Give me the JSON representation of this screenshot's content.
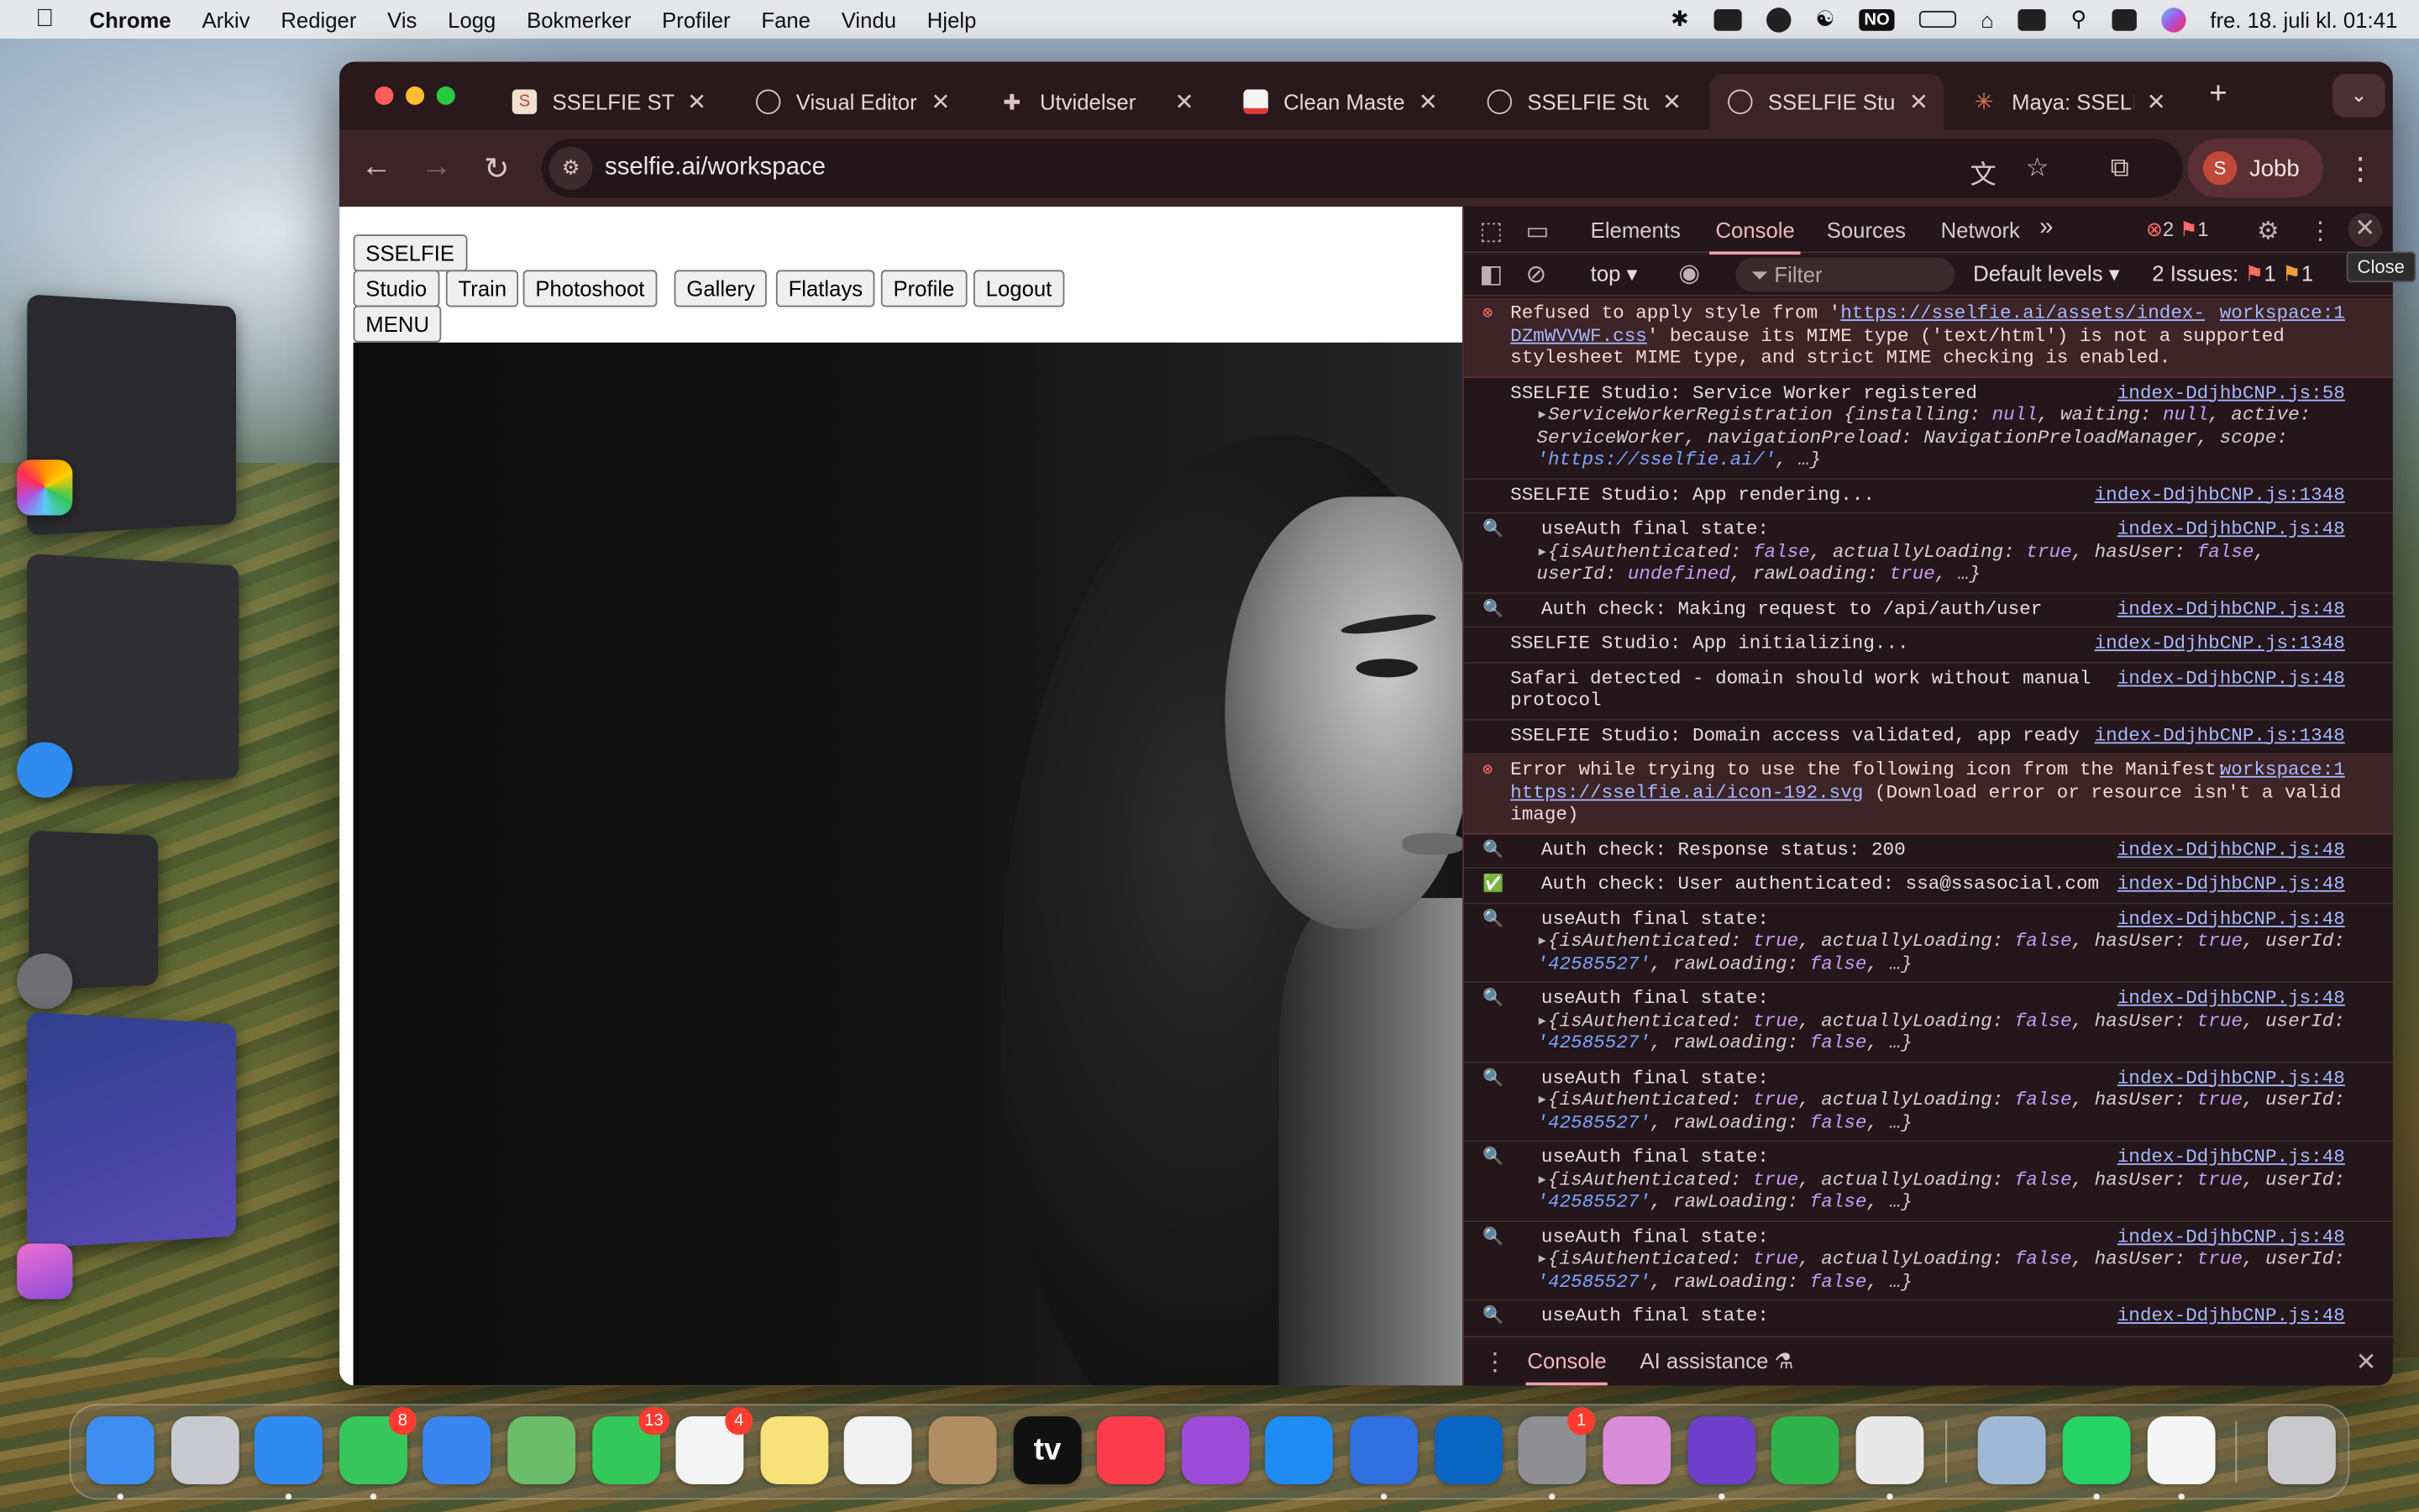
{
  "menubar": {
    "app_name": "Chrome",
    "items": [
      "Arkiv",
      "Rediger",
      "Vis",
      "Logg",
      "Bokmerker",
      "Profiler",
      "Fane",
      "Vindu",
      "Hjelp"
    ],
    "input_source": "NO",
    "clock": "fre. 18. juli kl. 01:41"
  },
  "tabs": [
    {
      "title": "SSELFIE STU",
      "icon": "sselfie-favicon"
    },
    {
      "title": "Visual Editor",
      "icon": "globe-icon"
    },
    {
      "title": "Utvidelser",
      "icon": "puzzle-icon"
    },
    {
      "title": "Clean Master",
      "icon": "clean-master-favicon"
    },
    {
      "title": "SSELFIE Stud",
      "icon": "globe-icon"
    },
    {
      "title": "SSELFIE Stud",
      "icon": "globe-icon"
    },
    {
      "title": "Maya: SSELF",
      "icon": "claude-favicon"
    }
  ],
  "active_tab_index": 5,
  "address": {
    "url": "sselfie.ai/workspace"
  },
  "profile": {
    "initial": "S",
    "name": "Jobb"
  },
  "page": {
    "logo_button": "SSELFIE",
    "nav": [
      "Studio",
      "Train",
      "Photoshoot",
      "Gallery",
      "Flatlays",
      "Profile",
      "Logout"
    ],
    "menu_button": "MENU"
  },
  "devtools": {
    "tabs": [
      "Elements",
      "Console",
      "Sources",
      "Network"
    ],
    "active_tab": "Console",
    "error_count": "2",
    "warning_count": "1",
    "context": "top",
    "filter_placeholder": "Filter",
    "levels": "Default levels",
    "issues_label": "2 Issues:",
    "issues_errors": "1",
    "issues_warnings": "1",
    "close_tooltip": "Close",
    "drawer_tabs": [
      "Console",
      "AI assistance"
    ],
    "messages": [
      {
        "type": "error",
        "text": "Refused to apply style from '",
        "link": "https://sselfie.ai/assets/index-DZmWVVWF.css",
        "text2": "' because its MIME type ('text/html') is not a supported stylesheet MIME type, and strict MIME checking is enabled.",
        "source": "workspace:1"
      },
      {
        "type": "log",
        "text": "SSELFIE Studio: Service Worker registered",
        "sub": "ServiceWorkerRegistration {installing: null, waiting: null, active: ServiceWorker, navigationPreload: NavigationPreloadManager, scope: 'https://sselfie.ai/', …}",
        "source": "index-DdjhbCNP.js:58"
      },
      {
        "type": "log",
        "text": "SSELFIE Studio: App rendering...",
        "source": "index-DdjhbCNP.js:1348"
      },
      {
        "type": "info",
        "text": "useAuth final state:",
        "sub": "{isAuthenticated: false, actuallyLoading: true, hasUser: false, userId: undefined, rawLoading: true, …}",
        "source": "index-DdjhbCNP.js:48"
      },
      {
        "type": "info",
        "text": "Auth check: Making request to /api/auth/user",
        "source": "index-DdjhbCNP.js:48"
      },
      {
        "type": "log",
        "text": "SSELFIE Studio: App initializing...",
        "source": "index-DdjhbCNP.js:1348"
      },
      {
        "type": "log",
        "text": "Safari detected - domain should work without manual protocol",
        "source": "index-DdjhbCNP.js:48"
      },
      {
        "type": "log",
        "text": "SSELFIE Studio: Domain access validated, app ready",
        "source": "index-DdjhbCNP.js:1348"
      },
      {
        "type": "error",
        "text": "Error while trying to use the following icon from the Manifest: ",
        "link": "https://sselfie.ai/icon-192.svg",
        "text2": " (Download error or resource isn't a valid image)",
        "source": "workspace:1"
      },
      {
        "type": "info",
        "text": "Auth check: Response status: 200",
        "source": "index-DdjhbCNP.js:48"
      },
      {
        "type": "success",
        "text": "Auth check: User authenticated: ssa@ssasocial.com",
        "source": "index-DdjhbCNP.js:48"
      },
      {
        "type": "info",
        "text": "useAuth final state:",
        "sub": "{isAuthenticated: true, actuallyLoading: false, hasUser: true, userId: '42585527', rawLoading: false, …}",
        "source": "index-DdjhbCNP.js:48"
      },
      {
        "type": "info",
        "text": "useAuth final state:",
        "sub": "{isAuthenticated: true, actuallyLoading: false, hasUser: true, userId: '42585527', rawLoading: false, …}",
        "source": "index-DdjhbCNP.js:48"
      },
      {
        "type": "info",
        "text": "useAuth final state:",
        "sub": "{isAuthenticated: true, actuallyLoading: false, hasUser: true, userId: '42585527', rawLoading: false, …}",
        "source": "index-DdjhbCNP.js:48"
      },
      {
        "type": "info",
        "text": "useAuth final state:",
        "sub": "{isAuthenticated: true, actuallyLoading: false, hasUser: true, userId: '42585527', rawLoading: false, …}",
        "source": "index-DdjhbCNP.js:48"
      },
      {
        "type": "info",
        "text": "useAuth final state:",
        "sub": "{isAuthenticated: true, actuallyLoading: false, hasUser: true, userId: '42585527', rawLoading: false, …}",
        "source": "index-DdjhbCNP.js:48"
      },
      {
        "type": "info",
        "text": "useAuth final state:",
        "source": "index-DdjhbCNP.js:48"
      }
    ]
  },
  "dock": {
    "apps": [
      {
        "name": "finder-icon",
        "color": "#3d8ef0"
      },
      {
        "name": "launchpad-icon",
        "color": "#c9c9d1"
      },
      {
        "name": "safari-icon",
        "color": "#2f8bf0"
      },
      {
        "name": "messages-icon",
        "color": "#35c759",
        "badge": "8"
      },
      {
        "name": "mail-icon",
        "color": "#3a86f0"
      },
      {
        "name": "maps-icon",
        "color": "#6bbd6a"
      },
      {
        "name": "facetime-icon",
        "color": "#34c759",
        "badge": "13"
      },
      {
        "name": "reminders-icon",
        "color": "#f4f4f4",
        "badge": "4"
      },
      {
        "name": "notes-icon",
        "color": "#f7e27a"
      },
      {
        "name": "freeform-icon",
        "color": "#f2f2f2"
      },
      {
        "name": "contacts-icon",
        "color": "#b08d63"
      },
      {
        "name": "apple-tv-icon",
        "color": "#111111",
        "label": "tv"
      },
      {
        "name": "music-icon",
        "color": "#fa3c4c"
      },
      {
        "name": "podcasts-icon",
        "color": "#9b4bd8"
      },
      {
        "name": "app-store-icon",
        "color": "#1f8cf4"
      },
      {
        "name": "blue-cube-app-icon",
        "color": "#2f6fe0"
      },
      {
        "name": "outlook-icon",
        "color": "#0a64c2"
      },
      {
        "name": "system-settings-icon",
        "color": "#8e8e93",
        "badge": "1"
      },
      {
        "name": "imac-app-icon",
        "color": "#d88bd8"
      },
      {
        "name": "github-icon",
        "color": "#6e40c9"
      },
      {
        "name": "numbers-icon",
        "color": "#30b24a"
      },
      {
        "name": "chrome-icon",
        "color": "#e8e8e8"
      },
      {
        "name": "preview-icon",
        "color": "#9fb8d6"
      },
      {
        "name": "whatsapp-icon",
        "color": "#25d366"
      },
      {
        "name": "photos-icon",
        "color": "#f5f5f5"
      },
      {
        "name": "trash-icon",
        "color": "#c9c9cc"
      }
    ]
  }
}
